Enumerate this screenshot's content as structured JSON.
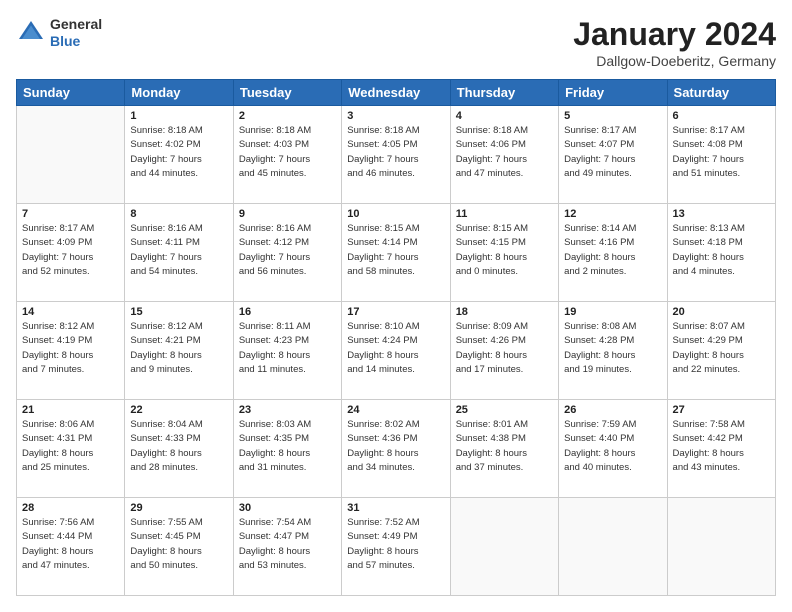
{
  "logo": {
    "general": "General",
    "blue": "Blue"
  },
  "title": "January 2024",
  "location": "Dallgow-Doeberitz, Germany",
  "weekdays": [
    "Sunday",
    "Monday",
    "Tuesday",
    "Wednesday",
    "Thursday",
    "Friday",
    "Saturday"
  ],
  "days": [
    {
      "num": "",
      "sunrise": "",
      "sunset": "",
      "daylight": ""
    },
    {
      "num": "1",
      "sunrise": "Sunrise: 8:18 AM",
      "sunset": "Sunset: 4:02 PM",
      "daylight": "Daylight: 7 hours and 44 minutes."
    },
    {
      "num": "2",
      "sunrise": "Sunrise: 8:18 AM",
      "sunset": "Sunset: 4:03 PM",
      "daylight": "Daylight: 7 hours and 45 minutes."
    },
    {
      "num": "3",
      "sunrise": "Sunrise: 8:18 AM",
      "sunset": "Sunset: 4:05 PM",
      "daylight": "Daylight: 7 hours and 46 minutes."
    },
    {
      "num": "4",
      "sunrise": "Sunrise: 8:18 AM",
      "sunset": "Sunset: 4:06 PM",
      "daylight": "Daylight: 7 hours and 47 minutes."
    },
    {
      "num": "5",
      "sunrise": "Sunrise: 8:17 AM",
      "sunset": "Sunset: 4:07 PM",
      "daylight": "Daylight: 7 hours and 49 minutes."
    },
    {
      "num": "6",
      "sunrise": "Sunrise: 8:17 AM",
      "sunset": "Sunset: 4:08 PM",
      "daylight": "Daylight: 7 hours and 51 minutes."
    },
    {
      "num": "7",
      "sunrise": "Sunrise: 8:17 AM",
      "sunset": "Sunset: 4:09 PM",
      "daylight": "Daylight: 7 hours and 52 minutes."
    },
    {
      "num": "8",
      "sunrise": "Sunrise: 8:16 AM",
      "sunset": "Sunset: 4:11 PM",
      "daylight": "Daylight: 7 hours and 54 minutes."
    },
    {
      "num": "9",
      "sunrise": "Sunrise: 8:16 AM",
      "sunset": "Sunset: 4:12 PM",
      "daylight": "Daylight: 7 hours and 56 minutes."
    },
    {
      "num": "10",
      "sunrise": "Sunrise: 8:15 AM",
      "sunset": "Sunset: 4:14 PM",
      "daylight": "Daylight: 7 hours and 58 minutes."
    },
    {
      "num": "11",
      "sunrise": "Sunrise: 8:15 AM",
      "sunset": "Sunset: 4:15 PM",
      "daylight": "Daylight: 8 hours and 0 minutes."
    },
    {
      "num": "12",
      "sunrise": "Sunrise: 8:14 AM",
      "sunset": "Sunset: 4:16 PM",
      "daylight": "Daylight: 8 hours and 2 minutes."
    },
    {
      "num": "13",
      "sunrise": "Sunrise: 8:13 AM",
      "sunset": "Sunset: 4:18 PM",
      "daylight": "Daylight: 8 hours and 4 minutes."
    },
    {
      "num": "14",
      "sunrise": "Sunrise: 8:12 AM",
      "sunset": "Sunset: 4:19 PM",
      "daylight": "Daylight: 8 hours and 7 minutes."
    },
    {
      "num": "15",
      "sunrise": "Sunrise: 8:12 AM",
      "sunset": "Sunset: 4:21 PM",
      "daylight": "Daylight: 8 hours and 9 minutes."
    },
    {
      "num": "16",
      "sunrise": "Sunrise: 8:11 AM",
      "sunset": "Sunset: 4:23 PM",
      "daylight": "Daylight: 8 hours and 11 minutes."
    },
    {
      "num": "17",
      "sunrise": "Sunrise: 8:10 AM",
      "sunset": "Sunset: 4:24 PM",
      "daylight": "Daylight: 8 hours and 14 minutes."
    },
    {
      "num": "18",
      "sunrise": "Sunrise: 8:09 AM",
      "sunset": "Sunset: 4:26 PM",
      "daylight": "Daylight: 8 hours and 17 minutes."
    },
    {
      "num": "19",
      "sunrise": "Sunrise: 8:08 AM",
      "sunset": "Sunset: 4:28 PM",
      "daylight": "Daylight: 8 hours and 19 minutes."
    },
    {
      "num": "20",
      "sunrise": "Sunrise: 8:07 AM",
      "sunset": "Sunset: 4:29 PM",
      "daylight": "Daylight: 8 hours and 22 minutes."
    },
    {
      "num": "21",
      "sunrise": "Sunrise: 8:06 AM",
      "sunset": "Sunset: 4:31 PM",
      "daylight": "Daylight: 8 hours and 25 minutes."
    },
    {
      "num": "22",
      "sunrise": "Sunrise: 8:04 AM",
      "sunset": "Sunset: 4:33 PM",
      "daylight": "Daylight: 8 hours and 28 minutes."
    },
    {
      "num": "23",
      "sunrise": "Sunrise: 8:03 AM",
      "sunset": "Sunset: 4:35 PM",
      "daylight": "Daylight: 8 hours and 31 minutes."
    },
    {
      "num": "24",
      "sunrise": "Sunrise: 8:02 AM",
      "sunset": "Sunset: 4:36 PM",
      "daylight": "Daylight: 8 hours and 34 minutes."
    },
    {
      "num": "25",
      "sunrise": "Sunrise: 8:01 AM",
      "sunset": "Sunset: 4:38 PM",
      "daylight": "Daylight: 8 hours and 37 minutes."
    },
    {
      "num": "26",
      "sunrise": "Sunrise: 7:59 AM",
      "sunset": "Sunset: 4:40 PM",
      "daylight": "Daylight: 8 hours and 40 minutes."
    },
    {
      "num": "27",
      "sunrise": "Sunrise: 7:58 AM",
      "sunset": "Sunset: 4:42 PM",
      "daylight": "Daylight: 8 hours and 43 minutes."
    },
    {
      "num": "28",
      "sunrise": "Sunrise: 7:56 AM",
      "sunset": "Sunset: 4:44 PM",
      "daylight": "Daylight: 8 hours and 47 minutes."
    },
    {
      "num": "29",
      "sunrise": "Sunrise: 7:55 AM",
      "sunset": "Sunset: 4:45 PM",
      "daylight": "Daylight: 8 hours and 50 minutes."
    },
    {
      "num": "30",
      "sunrise": "Sunrise: 7:54 AM",
      "sunset": "Sunset: 4:47 PM",
      "daylight": "Daylight: 8 hours and 53 minutes."
    },
    {
      "num": "31",
      "sunrise": "Sunrise: 7:52 AM",
      "sunset": "Sunset: 4:49 PM",
      "daylight": "Daylight: 8 hours and 57 minutes."
    }
  ]
}
